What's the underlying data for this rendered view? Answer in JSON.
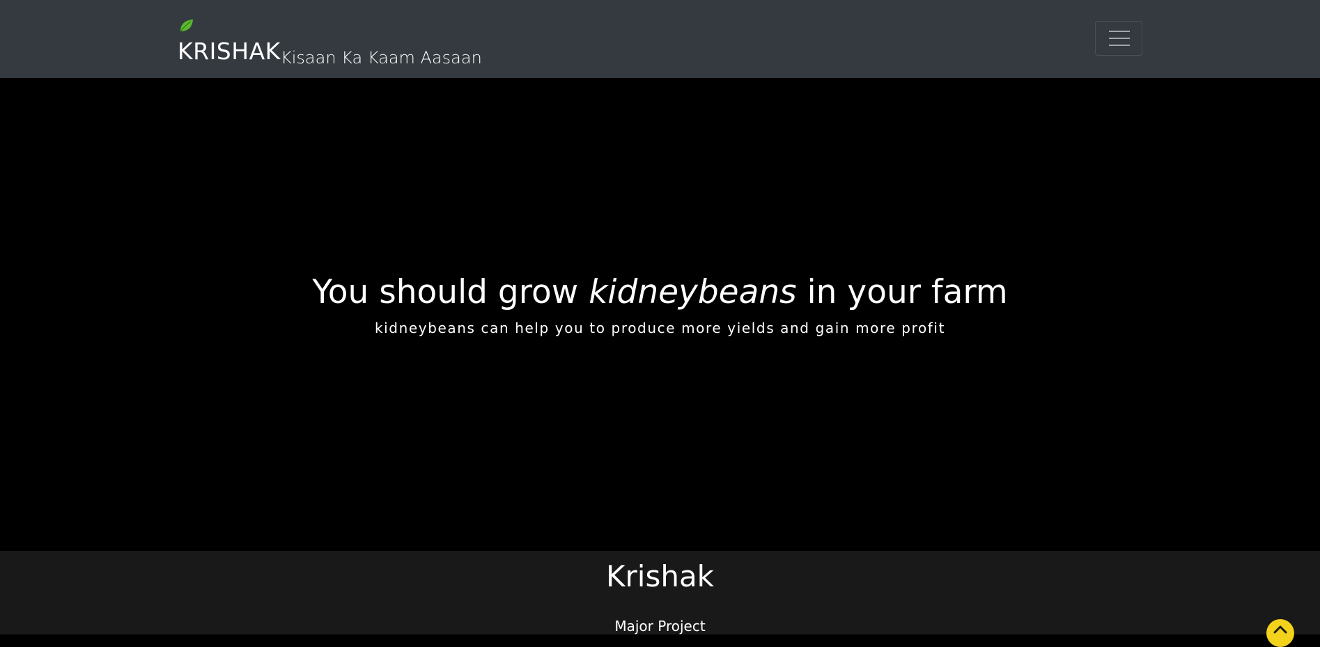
{
  "navbar": {
    "brand_name": "KRISHAK",
    "tagline": "Kisaan Ka Kaam Aasaan",
    "logo_icon": "leaf-icon",
    "menu_icon": "hamburger-menu-icon"
  },
  "hero": {
    "title_prefix": "You should grow ",
    "crop": "kidneybeans",
    "title_suffix": " in your farm",
    "subtitle": "kidneybeans can help you to produce more yields and gain more profit"
  },
  "footer": {
    "title": "Krishak",
    "subtitle": "Major Project"
  },
  "back_to_top": {
    "icon": "chevron-up-icon"
  },
  "colors": {
    "navbar_bg": "#343a40",
    "hero_bg": "#000000",
    "footer_bg": "#191919",
    "leaf_green": "#5cb82e",
    "back_to_top_yellow": "#f2d21b"
  }
}
